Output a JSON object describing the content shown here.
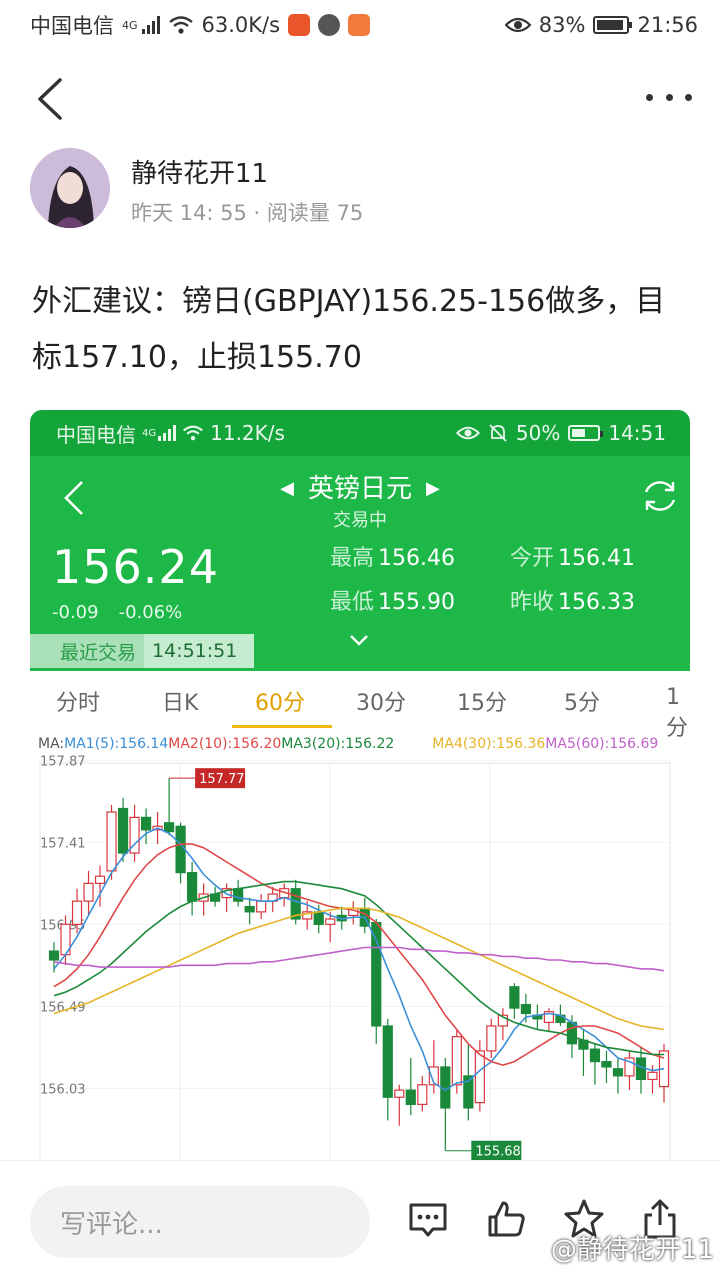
{
  "statusbar": {
    "carrier": "中国电信",
    "network": "4G",
    "speed": "63.0K/s",
    "battery": "83%",
    "time": "21:56"
  },
  "author": {
    "name": "静待花开11",
    "meta": "昨天 14: 55 · 阅读量 75"
  },
  "post": {
    "text": "外汇建议：镑日(GBPJAY)156.25-156做多，目标157.10，止损155.70"
  },
  "screenshot": {
    "statusbar": {
      "carrier": "中国电信",
      "network": "4G",
      "speed": "11.2K/s",
      "battery": "50%",
      "time": "14:51"
    },
    "title": "英镑日元",
    "subtitle": "交易中",
    "price": "156.24",
    "change": "-0.09",
    "change_pct": "-0.06%",
    "high_label": "最高",
    "high": "156.46",
    "open_label": "今开",
    "open": "156.41",
    "low_label": "最低",
    "low": "155.90",
    "prev_label": "昨收",
    "prev": "156.33",
    "recent_label": "最近交易",
    "recent_time": "14:51:51",
    "tabs": [
      "分时",
      "日K",
      "60分",
      "30分",
      "15分",
      "5分",
      "1分"
    ],
    "active_tab": 2,
    "ma_prefix": "MA:",
    "ma": [
      {
        "label": "MA1(5):156.14",
        "color": "#3a8fd8"
      },
      {
        "label": "MA2(10):156.20",
        "color": "#e04848"
      },
      {
        "label": "MA3(20):156.22",
        "color": "#1a8a3a"
      },
      {
        "label": "MA4(30):156.36",
        "color": "#e6b428"
      },
      {
        "label": "MA5(60):156.69",
        "color": "#c061c9"
      }
    ]
  },
  "chart_data": {
    "type": "candlestick",
    "y_ticks": [
      "157.87",
      "157.41",
      "156.95",
      "156.49",
      "156.03"
    ],
    "ylim": [
      155.6,
      157.9
    ],
    "max_label": "157.77",
    "min_label": "155.68",
    "up_color": "#d9363e",
    "down_color": "#1a8a3a",
    "candles": [
      [
        156.8,
        156.85,
        156.68,
        156.75
      ],
      [
        156.78,
        157.0,
        156.72,
        156.95
      ],
      [
        156.95,
        157.15,
        156.9,
        157.08
      ],
      [
        157.08,
        157.25,
        157.0,
        157.18
      ],
      [
        157.18,
        157.28,
        157.05,
        157.22
      ],
      [
        157.25,
        157.62,
        157.2,
        157.58
      ],
      [
        157.6,
        157.66,
        157.3,
        157.35
      ],
      [
        157.35,
        157.62,
        157.3,
        157.55
      ],
      [
        157.55,
        157.6,
        157.4,
        157.48
      ],
      [
        157.48,
        157.58,
        157.4,
        157.5
      ],
      [
        157.52,
        157.77,
        157.45,
        157.47
      ],
      [
        157.5,
        157.52,
        157.18,
        157.24
      ],
      [
        157.24,
        157.3,
        157.0,
        157.08
      ],
      [
        157.08,
        157.18,
        157.0,
        157.12
      ],
      [
        157.12,
        157.16,
        157.05,
        157.08
      ],
      [
        157.1,
        157.18,
        157.02,
        157.15
      ],
      [
        157.15,
        157.2,
        157.05,
        157.08
      ],
      [
        157.05,
        157.1,
        156.95,
        157.02
      ],
      [
        157.02,
        157.12,
        156.98,
        157.08
      ],
      [
        157.08,
        157.16,
        157.02,
        157.12
      ],
      [
        157.1,
        157.18,
        157.05,
        157.15
      ],
      [
        157.15,
        157.2,
        156.95,
        156.98
      ],
      [
        156.98,
        157.08,
        156.92,
        157.02
      ],
      [
        157.02,
        157.06,
        156.9,
        156.95
      ],
      [
        156.95,
        157.02,
        156.85,
        156.98
      ],
      [
        157.0,
        157.05,
        156.92,
        156.97
      ],
      [
        157.0,
        157.08,
        156.95,
        157.04
      ],
      [
        157.04,
        157.1,
        156.9,
        156.94
      ],
      [
        156.96,
        156.98,
        156.28,
        156.38
      ],
      [
        156.38,
        156.42,
        155.85,
        155.98
      ],
      [
        155.98,
        156.05,
        155.82,
        156.02
      ],
      [
        156.02,
        156.2,
        155.88,
        155.94
      ],
      [
        155.94,
        156.1,
        155.9,
        156.05
      ],
      [
        156.05,
        156.3,
        156.0,
        156.15
      ],
      [
        156.15,
        156.2,
        155.68,
        155.92
      ],
      [
        156.05,
        156.36,
        156.0,
        156.32
      ],
      [
        156.1,
        156.28,
        155.85,
        155.92
      ],
      [
        155.95,
        156.3,
        155.9,
        156.24
      ],
      [
        156.24,
        156.42,
        156.2,
        156.38
      ],
      [
        156.38,
        156.48,
        156.3,
        156.44
      ],
      [
        156.6,
        156.62,
        156.42,
        156.48
      ],
      [
        156.5,
        156.56,
        156.4,
        156.45
      ],
      [
        156.44,
        156.5,
        156.36,
        156.42
      ],
      [
        156.4,
        156.48,
        156.35,
        156.46
      ],
      [
        156.44,
        156.5,
        156.38,
        156.4
      ],
      [
        156.4,
        156.44,
        156.2,
        156.28
      ],
      [
        156.3,
        156.36,
        156.1,
        156.25
      ],
      [
        156.25,
        156.28,
        156.05,
        156.18
      ],
      [
        156.18,
        156.24,
        156.06,
        156.15
      ],
      [
        156.14,
        156.2,
        156.0,
        156.1
      ],
      [
        156.1,
        156.24,
        156.02,
        156.2
      ],
      [
        156.2,
        156.26,
        156.0,
        156.08
      ],
      [
        156.08,
        156.16,
        156.0,
        156.12
      ],
      [
        156.04,
        156.28,
        155.95,
        156.24
      ]
    ],
    "series": [
      {
        "name": "MA1(5)",
        "color": "#3a8fd8",
        "values": [
          156.7,
          156.78,
          156.88,
          157.0,
          157.12,
          157.24,
          157.33,
          157.4,
          157.46,
          157.49,
          157.46,
          157.4,
          157.32,
          157.23,
          157.17,
          157.12,
          157.1,
          157.09,
          157.08,
          157.08,
          157.1,
          157.08,
          157.06,
          157.03,
          157.0,
          156.98,
          156.99,
          156.99,
          156.86,
          156.7,
          156.55,
          156.38,
          156.24,
          156.06,
          156.02,
          156.06,
          156.07,
          156.13,
          156.18,
          156.26,
          156.36,
          156.43,
          156.44,
          156.45,
          156.44,
          156.4,
          156.36,
          156.32,
          156.26,
          156.2,
          156.18,
          156.15,
          156.13,
          156.14
        ]
      },
      {
        "name": "MA2(10)",
        "color": "#e04848",
        "values": [
          156.6,
          156.64,
          156.7,
          156.78,
          156.88,
          156.99,
          157.1,
          157.2,
          157.28,
          157.34,
          157.38,
          157.4,
          157.4,
          157.38,
          157.34,
          157.3,
          157.26,
          157.22,
          157.18,
          157.15,
          157.13,
          157.11,
          157.09,
          157.07,
          157.05,
          157.04,
          157.03,
          157.01,
          156.96,
          156.88,
          156.8,
          156.72,
          156.64,
          156.54,
          156.44,
          156.36,
          156.28,
          156.22,
          156.18,
          156.16,
          156.18,
          156.22,
          156.26,
          156.3,
          156.34,
          156.37,
          156.38,
          156.38,
          156.36,
          156.34,
          156.3,
          156.26,
          156.22,
          156.2
        ]
      },
      {
        "name": "MA3(20)",
        "color": "#1a8a3a",
        "values": [
          156.55,
          156.57,
          156.6,
          156.64,
          156.68,
          156.73,
          156.79,
          156.85,
          156.91,
          156.96,
          157.01,
          157.05,
          157.08,
          157.1,
          157.12,
          157.14,
          157.15,
          157.16,
          157.17,
          157.18,
          157.19,
          157.19,
          157.18,
          157.17,
          157.16,
          157.15,
          157.13,
          157.11,
          157.06,
          157.0,
          156.94,
          156.88,
          156.82,
          156.76,
          156.7,
          156.64,
          156.58,
          156.52,
          156.47,
          156.43,
          156.4,
          156.38,
          156.36,
          156.35,
          156.34,
          156.32,
          156.3,
          156.28,
          156.26,
          156.25,
          156.24,
          156.23,
          156.22,
          156.22
        ]
      },
      {
        "name": "MA4(30)",
        "color": "#e6b428",
        "values": [
          156.45,
          156.47,
          156.49,
          156.51,
          156.54,
          156.57,
          156.6,
          156.63,
          156.66,
          156.69,
          156.72,
          156.75,
          156.78,
          156.81,
          156.84,
          156.87,
          156.9,
          156.92,
          156.94,
          156.96,
          156.98,
          157.0,
          157.01,
          157.02,
          157.03,
          157.04,
          157.04,
          157.04,
          157.03,
          157.01,
          156.99,
          156.96,
          156.93,
          156.9,
          156.87,
          156.84,
          156.81,
          156.78,
          156.75,
          156.72,
          156.69,
          156.66,
          156.63,
          156.6,
          156.57,
          156.54,
          156.51,
          156.48,
          156.45,
          156.42,
          156.4,
          156.38,
          156.37,
          156.36
        ]
      },
      {
        "name": "MA5(60)",
        "color": "#c061c9",
        "values": [
          156.74,
          156.73,
          156.72,
          156.72,
          156.71,
          156.71,
          156.71,
          156.71,
          156.71,
          156.71,
          156.71,
          156.72,
          156.72,
          156.72,
          156.72,
          156.73,
          156.73,
          156.73,
          156.74,
          156.74,
          156.75,
          156.76,
          156.77,
          156.78,
          156.79,
          156.8,
          156.81,
          156.82,
          156.82,
          156.82,
          156.82,
          156.81,
          156.81,
          156.8,
          156.8,
          156.79,
          156.79,
          156.78,
          156.78,
          156.77,
          156.77,
          156.76,
          156.76,
          156.75,
          156.75,
          156.74,
          156.74,
          156.73,
          156.73,
          156.72,
          156.71,
          156.7,
          156.7,
          156.69
        ]
      }
    ]
  },
  "bottom": {
    "comment_placeholder": "写评论...",
    "watermark": "@静待花开11"
  }
}
